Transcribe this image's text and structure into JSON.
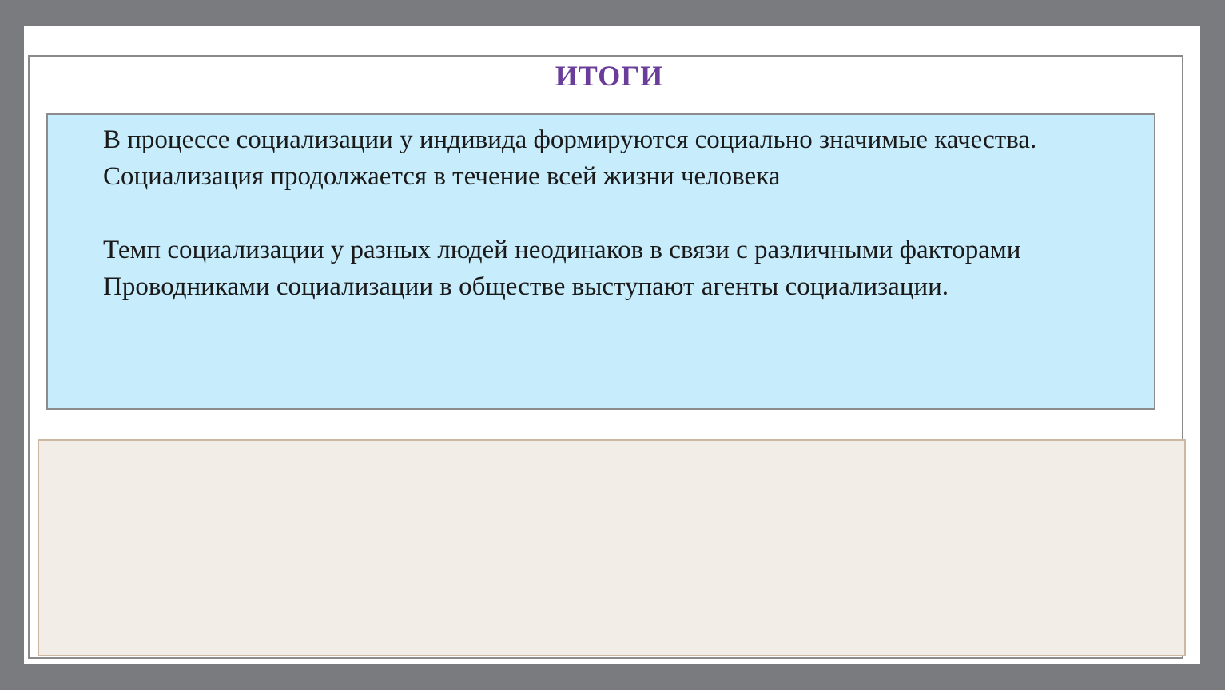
{
  "slide": {
    "title": "ИТОГИ",
    "paragraphs": [
      "В процессе социализации у индивида формируются социально значимые качества.",
      "Социализация продолжается в течение всей жизни человека",
      "Темп социализации у разных людей неодинаков в связи с различными факторами",
      "Проводниками социализации в обществе выступают агенты социализации."
    ]
  },
  "colors": {
    "background": "#7a7b7f",
    "title": "#6a3d9a",
    "box_fill": "#c7ecfb",
    "box_border": "#8c8c8c",
    "panel_fill": "#f2ede7",
    "panel_border": "#cbb9a0"
  }
}
